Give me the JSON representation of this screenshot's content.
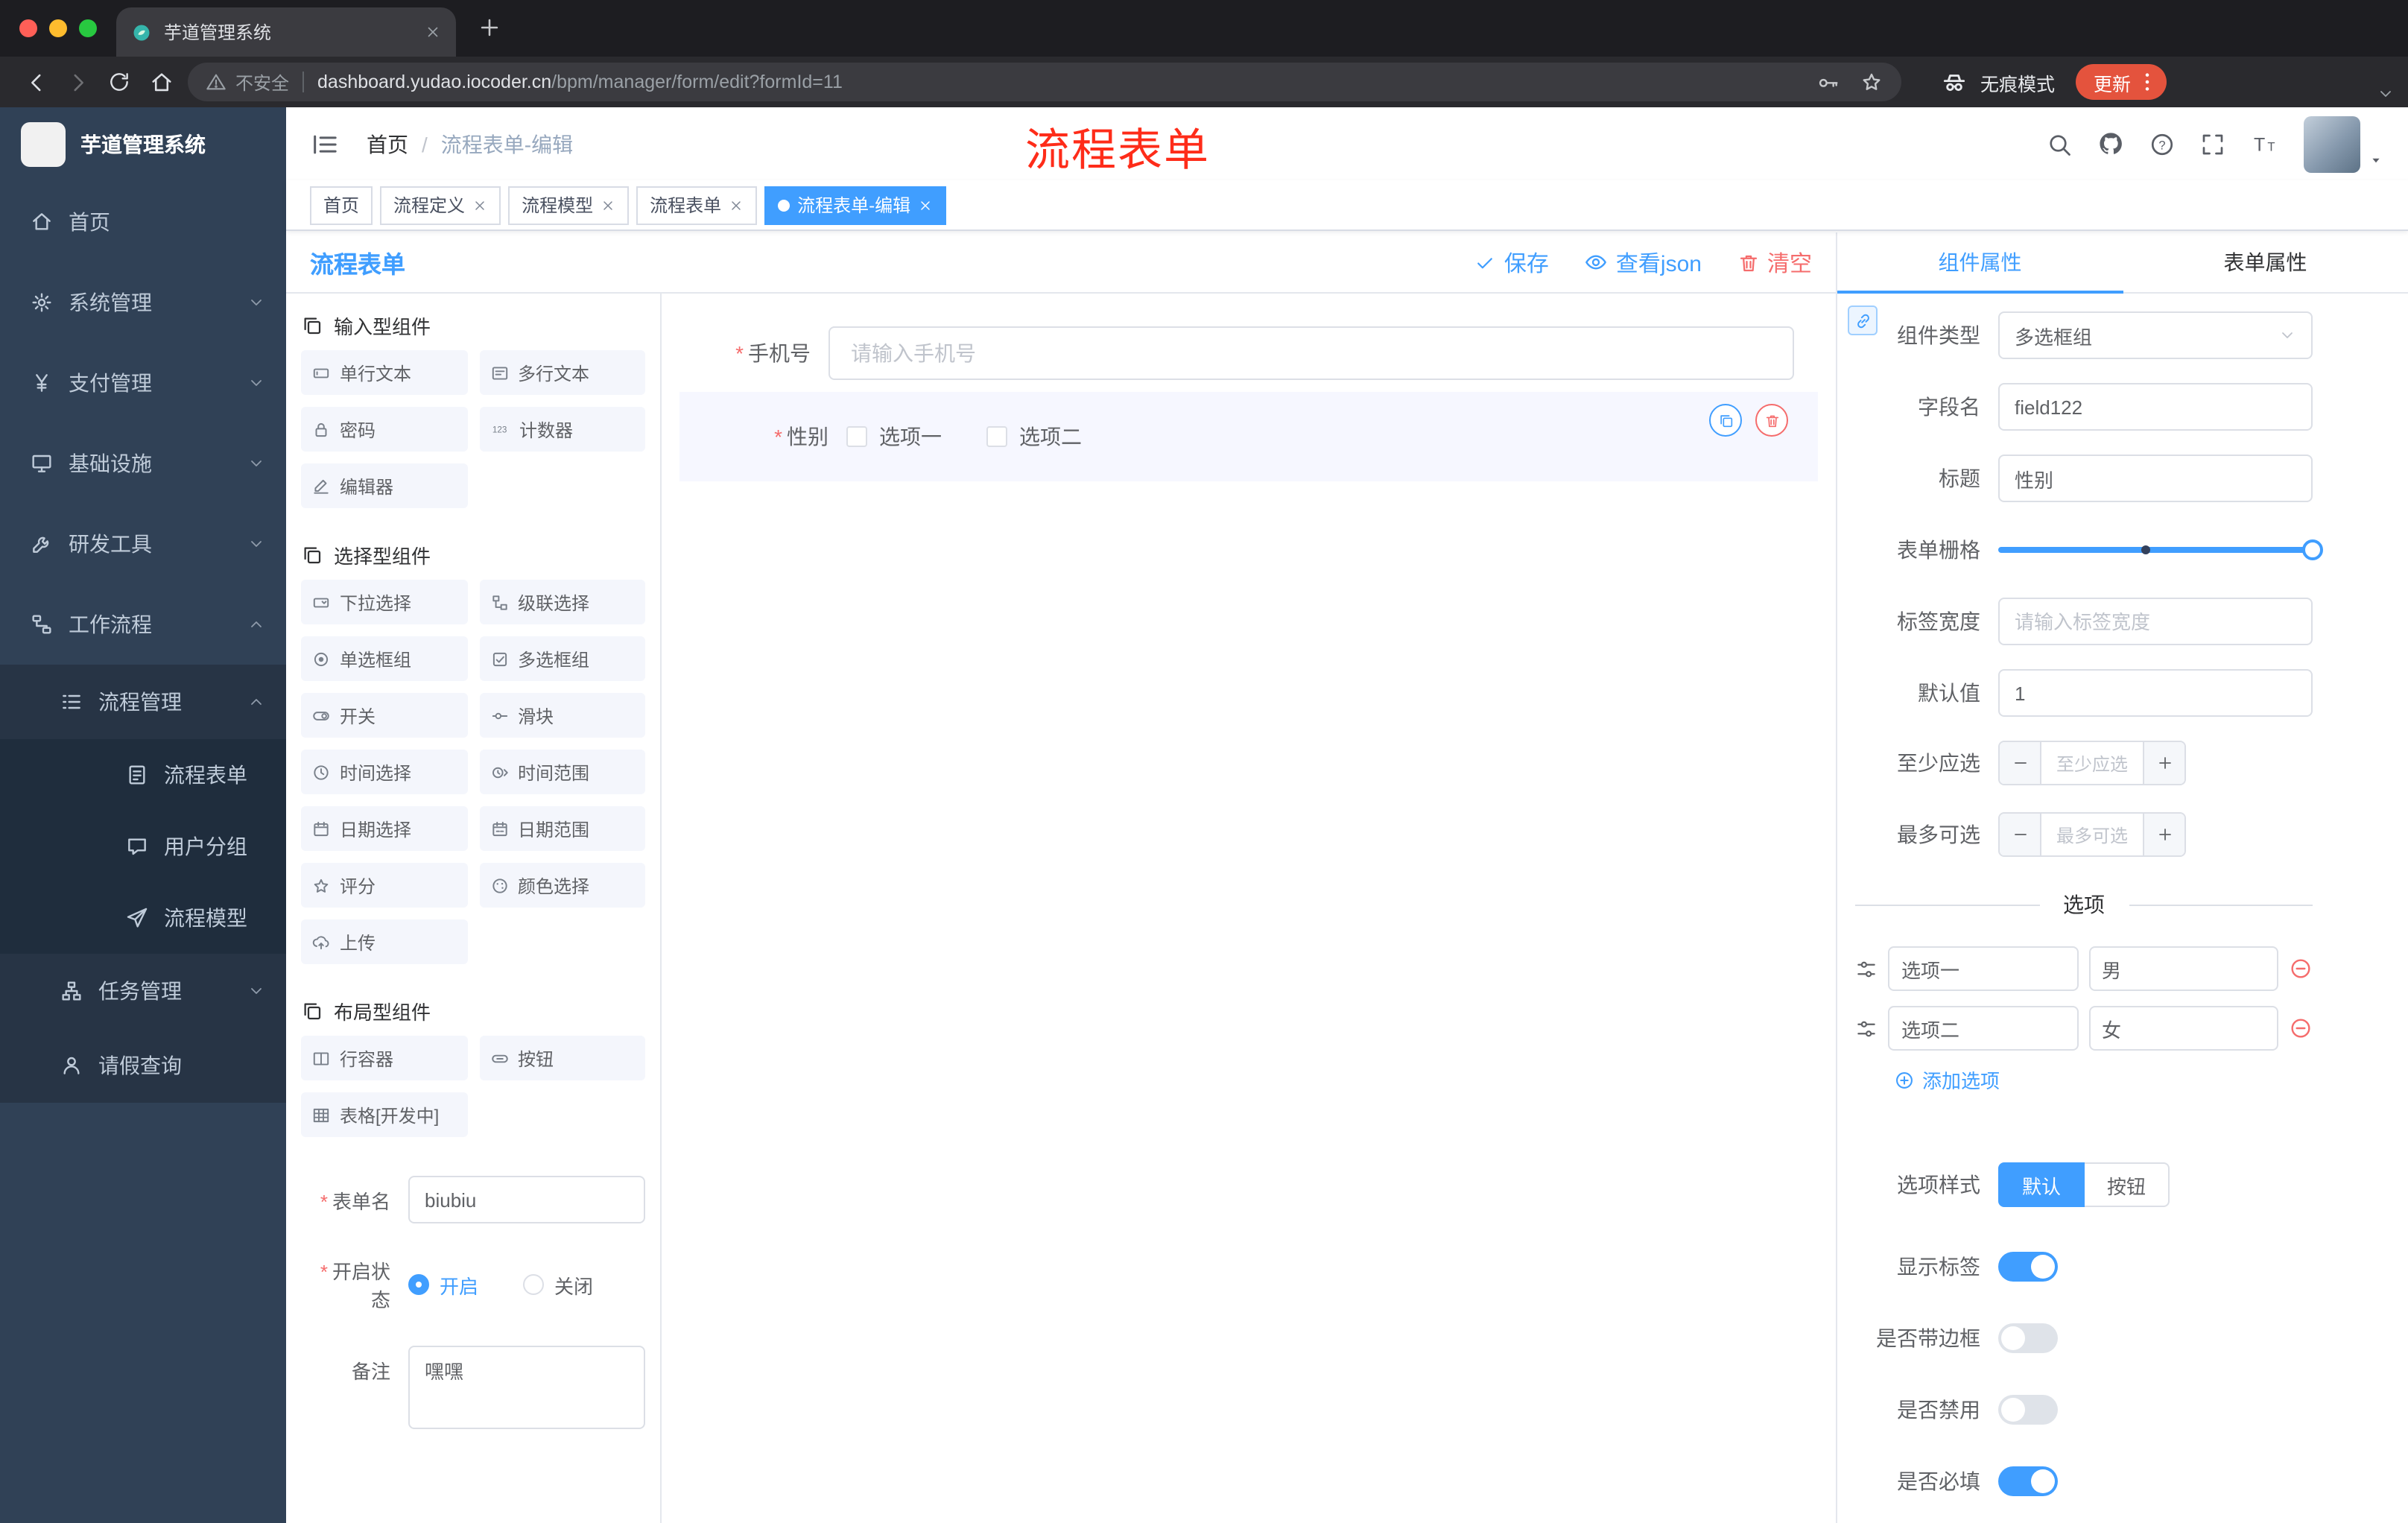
{
  "browser": {
    "tab_title": "芋道管理系统",
    "security_label": "不安全",
    "url_domain": "dashboard.yudao.iocoder.cn",
    "url_path": "/bpm/manager/form/edit?formId=11",
    "incognito_label": "无痕模式",
    "update_label": "更新"
  },
  "sidebar": {
    "logo_title": "芋道管理系统",
    "items": [
      {
        "label": "首页"
      },
      {
        "label": "系统管理"
      },
      {
        "label": "支付管理"
      },
      {
        "label": "基础设施"
      },
      {
        "label": "研发工具"
      },
      {
        "label": "工作流程"
      },
      {
        "label": "流程管理"
      },
      {
        "label": "流程表单"
      },
      {
        "label": "用户分组"
      },
      {
        "label": "流程模型"
      },
      {
        "label": "任务管理"
      },
      {
        "label": "请假查询"
      }
    ]
  },
  "header": {
    "breadcrumb": [
      "首页",
      "流程表单-编辑"
    ],
    "breadcrumb_separator": "/",
    "annotation": "流程表单"
  },
  "tags": [
    {
      "label": "首页",
      "active": false,
      "closable": false
    },
    {
      "label": "流程定义",
      "active": false,
      "closable": true
    },
    {
      "label": "流程模型",
      "active": false,
      "closable": true
    },
    {
      "label": "流程表单",
      "active": false,
      "closable": true
    },
    {
      "label": "流程表单-编辑",
      "active": true,
      "closable": true
    }
  ],
  "designer": {
    "title": "流程表单",
    "actions": {
      "save": "保存",
      "view_json": "查看json",
      "clear": "清空"
    },
    "groups": [
      {
        "title": "输入型组件",
        "items": [
          "单行文本",
          "多行文本",
          "密码",
          "计数器",
          "编辑器"
        ]
      },
      {
        "title": "选择型组件",
        "items": [
          "下拉选择",
          "级联选择",
          "单选框组",
          "多选框组",
          "开关",
          "滑块",
          "时间选择",
          "时间范围",
          "日期选择",
          "日期范围",
          "评分",
          "颜色选择",
          "上传"
        ]
      },
      {
        "title": "布局型组件",
        "items": [
          "行容器",
          "按钮",
          "表格[开发中]"
        ]
      }
    ],
    "meta": {
      "form_name_label": "表单名",
      "form_name_value": "biubiu",
      "status_label": "开启状态",
      "status_on": "开启",
      "status_off": "关闭",
      "status_selected": "开启",
      "remark_label": "备注",
      "remark_value": "嘿嘿"
    }
  },
  "canvas": {
    "phone": {
      "label": "手机号",
      "placeholder": "请输入手机号",
      "required": true
    },
    "gender": {
      "label": "性别",
      "required": true,
      "selected": true,
      "options": [
        "选项一",
        "选项二"
      ]
    }
  },
  "props": {
    "tabs": [
      "组件属性",
      "表单属性"
    ],
    "active_tab": "组件属性",
    "component_type": {
      "label": "组件类型",
      "value": "多选框组"
    },
    "field_name": {
      "label": "字段名",
      "value": "field122"
    },
    "title": {
      "label": "标题",
      "value": "性别"
    },
    "grid": {
      "label": "表单栅格",
      "value": 24,
      "max": 24,
      "mark": 12
    },
    "label_width": {
      "label": "标签宽度",
      "placeholder": "请输入标签宽度"
    },
    "default": {
      "label": "默认值",
      "value": "1"
    },
    "min": {
      "label": "至少应选",
      "placeholder": "至少应选"
    },
    "max": {
      "label": "最多可选",
      "placeholder": "最多可选"
    },
    "options_divider": "选项",
    "options": [
      {
        "label": "选项一",
        "value": "男"
      },
      {
        "label": "选项二",
        "value": "女"
      }
    ],
    "add_option": "添加选项",
    "option_style": {
      "label": "选项样式",
      "options": [
        "默认",
        "按钮"
      ],
      "selected": "默认"
    },
    "switches": [
      {
        "label": "显示标签",
        "on": true
      },
      {
        "label": "是否带边框",
        "on": false
      },
      {
        "label": "是否禁用",
        "on": false
      },
      {
        "label": "是否必填",
        "on": true
      }
    ],
    "colors": {
      "accent": "#409eff",
      "danger": "#f56c6c"
    }
  }
}
